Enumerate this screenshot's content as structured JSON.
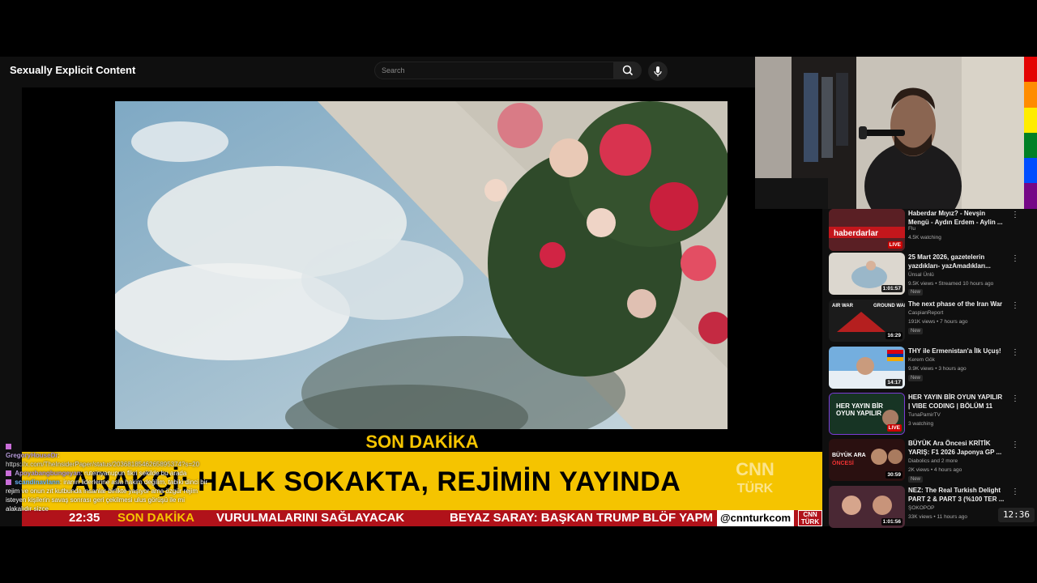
{
  "header": {
    "page_title": "Sexually Explicit Content",
    "search_placeholder": "Search",
    "search_icon": "search-icon",
    "mic_icon": "mic-icon"
  },
  "news": {
    "section_label": "SON DAKİKA",
    "headline": "ARAKÇİ: HALK SOKAKTA, REJİMİN YAYINDA",
    "channel_logo_line1": "CNN",
    "channel_logo_line2": "TÜRK",
    "ticker_clock": "22:35",
    "ticker_label": "SON DAKİKA",
    "ticker_text_1": "VURULMALARINI SAĞLAYACAK",
    "ticker_text_2": "BEYAZ SARAY: BAŞKAN TRUMP BLÖF YAPM",
    "ticker_handle": "@cnnturkcom",
    "ticker_cnn": "CNN TÜRK"
  },
  "chat": [
    {
      "user": "GregoryHouseDr",
      "message": "https://x.com/TheInsiderPaper/status/2036818546265895374?s=20"
    },
    {
      "user": "Apoyabangbungeyan",
      "message": "ruteinyanupun fikri sekilde bu arada"
    },
    {
      "user": "scandinavlann",
      "message": "iranın liderlerine asla hakim değilim, tabiki dinci bir rejim ve onun zıt kutbunda insanlar birlikte yaşıyor ama özgür rejim isteyen kişilerin savaş sonrası geri çekilmesi ulus görüşü ile mi alakalıdır sizce"
    }
  ],
  "sidebar": {
    "videos": [
      {
        "title": "Haberdar Mıyız? - Nevşin Mengü - Aydın Erdem - Aylin ...",
        "channel": "Flu",
        "meta": "4.5K watching",
        "badge": "LIVE",
        "badge_type": "live",
        "new": "",
        "thumb_color": "#6b2a2a"
      },
      {
        "title": "25 Mart 2026, gazetelerin yazdıkları- yazAmadıkları...",
        "channel": "Ünsal Ünlü",
        "meta": "9.5K views • Streamed 10 hours ago",
        "badge": "1:01:57",
        "badge_type": "duration",
        "new": "New",
        "thumb_color": "#c9c4bb"
      },
      {
        "title": "The next phase of the Iran War",
        "channel": "CaspianReport",
        "meta": "191K views • 7 hours ago",
        "badge": "16:29",
        "badge_type": "duration",
        "new": "New",
        "thumb_color": "#2b2b2b"
      },
      {
        "title": "THY ile Ermenistan'a İlk Uçuş!",
        "channel": "Kerem Gök",
        "meta": "9.9K views • 3 hours ago",
        "badge": "14:17",
        "badge_type": "duration",
        "new": "New",
        "thumb_color": "#4f8fc7"
      },
      {
        "title": "HER YAYIN BİR OYUN YAPILIR | VIBE CODING | BÖLÜM 11",
        "channel": "TunaPamirTV",
        "meta": "3 watching",
        "badge": "LIVE",
        "badge_type": "live",
        "new": "",
        "thumb_color": "#1d3d2a"
      },
      {
        "title": "BÜYÜK Ara Öncesi KRİTİK YARIŞ: F1 2026 Japonya GP ...",
        "channel": "Diabolics and 2 more",
        "meta": "2K views • 4 hours ago",
        "badge": "30:59",
        "badge_type": "duration",
        "new": "New",
        "thumb_color": "#3a1515"
      },
      {
        "title": "NEZ: The Real Turkish Delight PART 2 & PART 3 (%100 TER ...",
        "channel": "ŞOKOPOP",
        "meta": "33K views • 11 hours ago",
        "badge": "1:01:56",
        "badge_type": "duration",
        "new": "",
        "thumb_color": "#5a3140"
      }
    ]
  },
  "clock": "12:36",
  "colors": {
    "breaking_yellow": "#f5c400",
    "ticker_red": "#b1121a",
    "yt_bg": "#0f0f0f"
  }
}
